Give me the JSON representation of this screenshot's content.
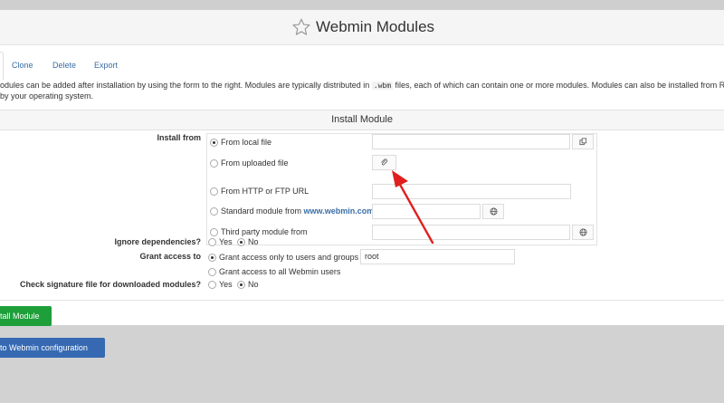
{
  "page": {
    "title": "Webmin Modules",
    "accent_color": "#1e9f3a",
    "link_color": "#3a6ea5",
    "star_icon": "star-outline-icon"
  },
  "tabs": [
    {
      "label": "Clone"
    },
    {
      "label": "Delete"
    },
    {
      "label": "Export"
    }
  ],
  "description": {
    "line1_a": "odules can be added after installation by using the form to the right. Modules are typically distributed in ",
    "line1_code": ".wbm",
    "line1_b": " files, each of which can contain one or more modules. Modules can also be installed from RPM",
    "line2": "by your operating system."
  },
  "install": {
    "section_title": "Install Module",
    "install_from_label": "Install from",
    "sources": [
      {
        "label": "From local file",
        "selected": true,
        "value": ""
      },
      {
        "label": "From uploaded file",
        "selected": false,
        "value": ""
      },
      {
        "label": "From HTTP or FTP URL",
        "selected": false,
        "value": ""
      },
      {
        "label": "Standard module from ",
        "link": "www.webmin.com",
        "selected": false,
        "value": ""
      },
      {
        "label": "Third party module from",
        "selected": false,
        "value": ""
      }
    ],
    "ignore_deps": {
      "label": "Ignore dependencies?",
      "yes": "Yes",
      "no": "No",
      "selected": "No"
    },
    "grant": {
      "label": "Grant access to",
      "option_only": "Grant access only to users and groups :",
      "users_value": "root",
      "option_all": "Grant access to all Webmin users",
      "selected": "only"
    },
    "check_sig": {
      "label": "Check signature file for downloaded modules?",
      "yes": "Yes",
      "no": "No",
      "selected": "No"
    },
    "submit_label": "tall Module"
  },
  "return_label": "to Webmin configuration"
}
